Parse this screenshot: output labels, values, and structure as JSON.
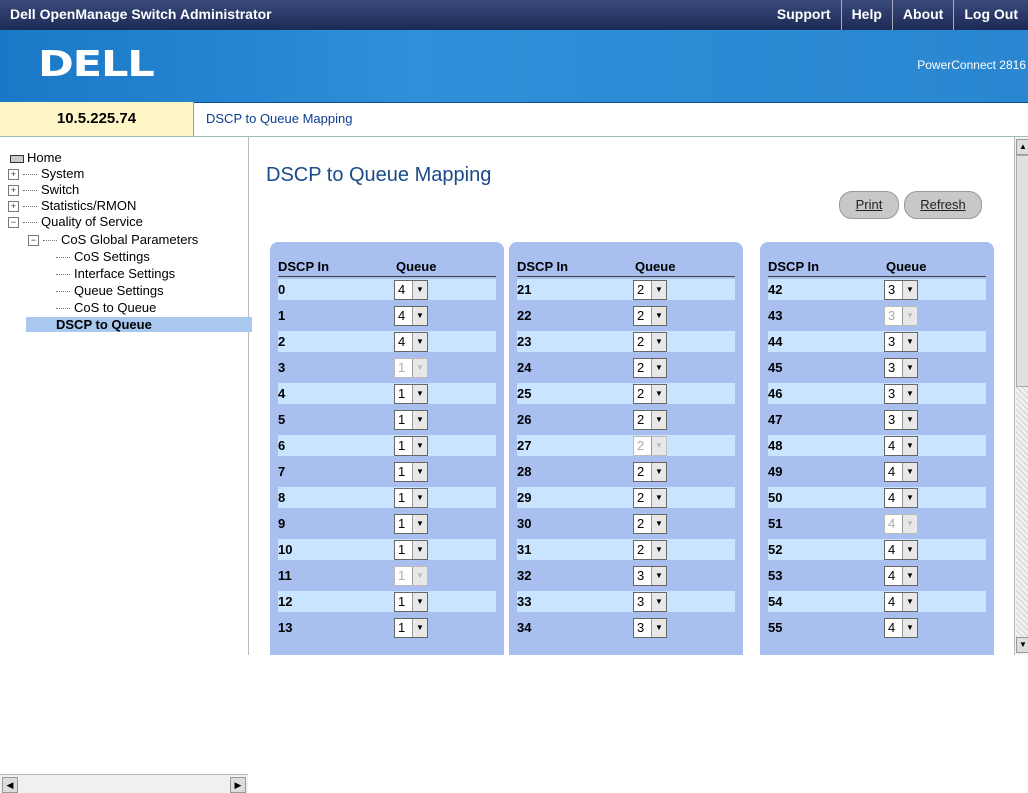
{
  "app": {
    "title": "Dell OpenManage Switch Administrator"
  },
  "topnav": [
    "Support",
    "Help",
    "About",
    "Log Out"
  ],
  "banner": {
    "logo": "DELL",
    "product": "PowerConnect 2816"
  },
  "ip": "10.5.225.74",
  "breadcrumb": "DSCP to Queue Mapping",
  "tree": [
    {
      "label": "Home",
      "exp": ""
    },
    {
      "label": "System",
      "exp": "+"
    },
    {
      "label": "Switch",
      "exp": "+"
    },
    {
      "label": "Statistics/RMON",
      "exp": "+"
    },
    {
      "label": "Quality of Service",
      "exp": "-"
    },
    {
      "label": "CoS Global Parameters",
      "exp": "-"
    },
    {
      "label": "CoS Settings",
      "exp": ""
    },
    {
      "label": "Interface Settings",
      "exp": ""
    },
    {
      "label": "Queue Settings",
      "exp": ""
    },
    {
      "label": "CoS to Queue",
      "exp": ""
    },
    {
      "label": "DSCP to Queue",
      "exp": ""
    }
  ],
  "page": {
    "title": "DSCP to Queue Mapping",
    "print": "Print",
    "refresh": "Refresh"
  },
  "columns": {
    "dscp": "DSCP In",
    "queue": "Queue"
  },
  "panels": [
    [
      [
        "0",
        "4",
        false
      ],
      [
        "1",
        "4",
        false
      ],
      [
        "2",
        "4",
        false
      ],
      [
        "3",
        "1",
        true
      ],
      [
        "4",
        "1",
        false
      ],
      [
        "5",
        "1",
        false
      ],
      [
        "6",
        "1",
        false
      ],
      [
        "7",
        "1",
        false
      ],
      [
        "8",
        "1",
        false
      ],
      [
        "9",
        "1",
        false
      ],
      [
        "10",
        "1",
        false
      ],
      [
        "11",
        "1",
        true
      ],
      [
        "12",
        "1",
        false
      ],
      [
        "13",
        "1",
        false
      ]
    ],
    [
      [
        "21",
        "2",
        false
      ],
      [
        "22",
        "2",
        false
      ],
      [
        "23",
        "2",
        false
      ],
      [
        "24",
        "2",
        false
      ],
      [
        "25",
        "2",
        false
      ],
      [
        "26",
        "2",
        false
      ],
      [
        "27",
        "2",
        true
      ],
      [
        "28",
        "2",
        false
      ],
      [
        "29",
        "2",
        false
      ],
      [
        "30",
        "2",
        false
      ],
      [
        "31",
        "2",
        false
      ],
      [
        "32",
        "3",
        false
      ],
      [
        "33",
        "3",
        false
      ],
      [
        "34",
        "3",
        false
      ]
    ],
    [
      [
        "42",
        "3",
        false
      ],
      [
        "43",
        "3",
        true
      ],
      [
        "44",
        "3",
        false
      ],
      [
        "45",
        "3",
        false
      ],
      [
        "46",
        "3",
        false
      ],
      [
        "47",
        "3",
        false
      ],
      [
        "48",
        "4",
        false
      ],
      [
        "49",
        "4",
        false
      ],
      [
        "50",
        "4",
        false
      ],
      [
        "51",
        "4",
        true
      ],
      [
        "52",
        "4",
        false
      ],
      [
        "53",
        "4",
        false
      ],
      [
        "54",
        "4",
        false
      ],
      [
        "55",
        "4",
        false
      ]
    ]
  ]
}
